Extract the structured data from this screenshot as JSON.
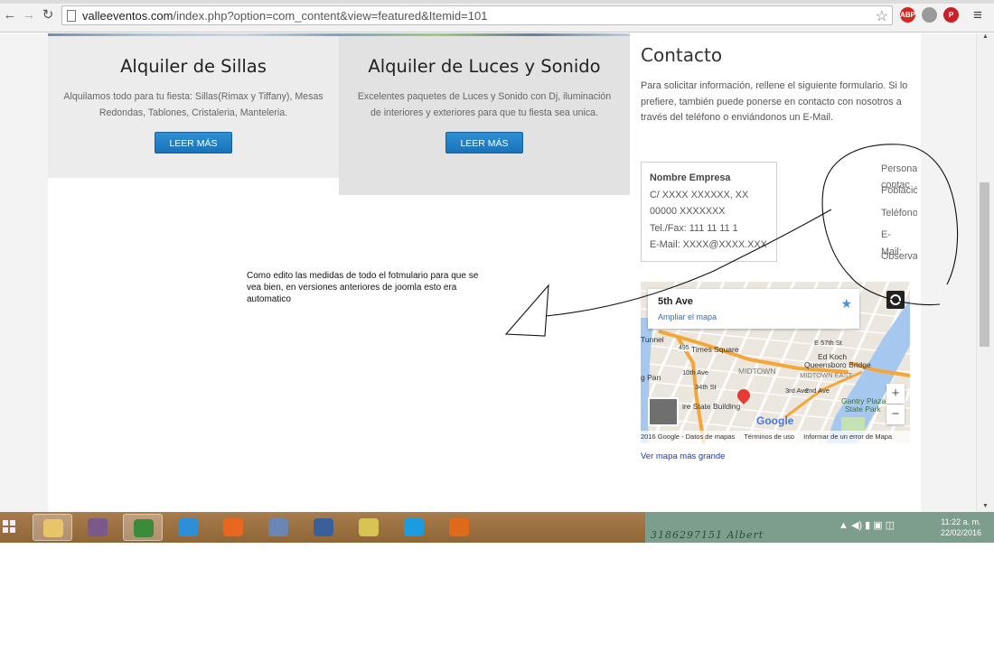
{
  "browser": {
    "url_domain": "valleeventos.com",
    "url_path": "/index.php?option=com_content&view=featured&Itemid=101",
    "extensions": [
      {
        "name": "adblock-plus-icon",
        "label": "ABP",
        "color": "#d9261c"
      },
      {
        "name": "extension-gear-icon",
        "label": "",
        "color": "#9a9a9a"
      },
      {
        "name": "pinterest-icon",
        "label": "P",
        "color": "#cb2027"
      }
    ]
  },
  "features": [
    {
      "title": "Alquiler de Sillas",
      "text": "Alquilamos todo para tu fiesta: Sillas(Rimax y Tiffany), Mesas Redondas, Tablones, Cristaleria, Manteleria.",
      "button": "LEER MÁS"
    },
    {
      "title": "Alquiler de Luces y Sonido",
      "text": "Excelentes paquetes de Luces y Sonido con Dj, iluminación de interiores y exteriores para que tu fiesta sea unica.",
      "button": "LEER MÁS"
    }
  ],
  "note": "Como edito las medidas de todo el fotmulario para que se vea bien, en versiones anteriores de joomla esto era automatico",
  "contact": {
    "title": "Contacto",
    "intro": "Para solicitar información, rellene el siguiente formulario. Si lo prefiere, también puede ponerse en contacto con nosotros  a través del teléfono o enviándonos un E-Mail.",
    "address": {
      "company": "Nombre Empresa",
      "street": "C/ XXXX XXXXXX, XX",
      "postal": "00000 XXXXXXX",
      "phone": "Tel./Fax: 111 11 11 1",
      "email": "E-Mail: XXXX@XXXX.XXX"
    },
    "form_labels": {
      "persona": "Persona de contacto",
      "poblacion": "Población",
      "telefono": "Teléfono",
      "email_a": "E-",
      "email_b": "Mail:",
      "observaciones": "Observaciones"
    }
  },
  "map": {
    "place": "5th Ave",
    "enlarge": "Ampliar el mapa",
    "labels": {
      "times_square": "Times Square",
      "route": "495",
      "midtown": "MIDTOWN",
      "midtown_east": "MIDTOWN EAST",
      "ed_koch": "Ed Koch",
      "queensboro": "Queensboro Bridge",
      "state_building": "ire State Building",
      "gantry": "Gantry Plaza",
      "state_park": "State Park",
      "tunnel": "Tunnel",
      "pan": "g Pan",
      "st57": "E 57th St",
      "st34": "34th St",
      "ave10": "10th Ave",
      "ave3": "3rd Ave",
      "ave2": "2nd Ave"
    },
    "zoom_in": "+",
    "zoom_out": "−",
    "google": "Google",
    "footer": [
      "2016 Google - Datos de mapas",
      "Términos de uso",
      "Informar de un error de Mapa"
    ],
    "big_link": "Ver mapa más grande",
    "colors": {
      "water": "#a7c8ee",
      "park": "#c5e2b3",
      "highway": "#f4a63a",
      "street": "#ffffff"
    }
  },
  "taskbar": {
    "apps": [
      {
        "name": "file-explorer-icon",
        "color": "#e8c46a",
        "active": true
      },
      {
        "name": "itunes-icon",
        "color": "#7a5a8c",
        "active": false
      },
      {
        "name": "chrome-icon",
        "color": "#3b8b3d",
        "active": true
      },
      {
        "name": "internet-explorer-icon",
        "color": "#2d8fd8",
        "active": false
      },
      {
        "name": "firefox-icon",
        "color": "#e9661f",
        "active": false
      },
      {
        "name": "calculator-icon",
        "color": "#6b86b4",
        "active": false
      },
      {
        "name": "network-icon",
        "color": "#3a5f9a",
        "active": false
      },
      {
        "name": "folder-icon",
        "color": "#d8c355",
        "active": false
      },
      {
        "name": "skype-icon",
        "color": "#1d9be0",
        "active": false
      },
      {
        "name": "media-player-icon",
        "color": "#e06a1c",
        "active": false
      }
    ],
    "tray_label": "3186297151 Albert",
    "time": "11:22 a. m.",
    "date": "22/02/2016"
  }
}
